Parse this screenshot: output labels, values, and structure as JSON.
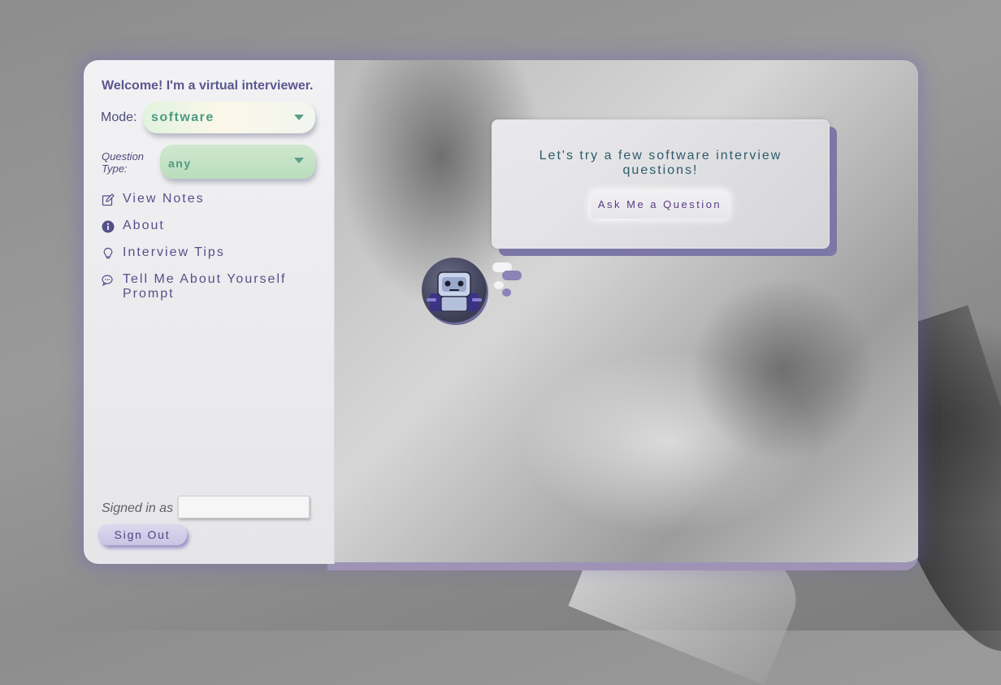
{
  "sidebar": {
    "welcome": "Welcome! I'm a virtual interviewer.",
    "mode_label": "Mode:",
    "mode_value": "software",
    "question_type_label": "Question Type:",
    "question_type_value": "any",
    "menu": [
      {
        "label": "View Notes",
        "icon": "edit-icon"
      },
      {
        "label": "About",
        "icon": "info-icon"
      },
      {
        "label": "Interview Tips",
        "icon": "lightbulb-icon"
      },
      {
        "label": "Tell Me About Yourself Prompt",
        "icon": "chat-bubbles-icon"
      }
    ],
    "signed_in_label": "Signed in as",
    "signed_in_value": "",
    "sign_out": "Sign Out"
  },
  "main": {
    "prompt_text": "Let's try a few software interview questions!",
    "ask_button": "Ask Me a Question",
    "avatar": "robot-avatar"
  },
  "colors": {
    "accent": "#55508a",
    "mode_text": "#4e9a83",
    "card_shadow": "#7d77a6"
  }
}
